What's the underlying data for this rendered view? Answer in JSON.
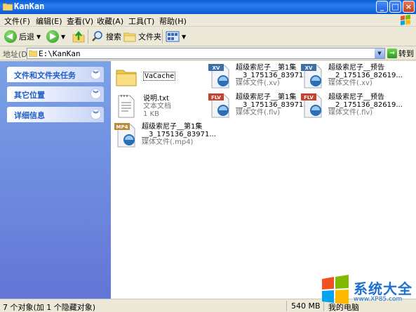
{
  "window": {
    "title": "KanKan",
    "minimize": "_",
    "maximize": "□",
    "close": "×"
  },
  "menu": [
    "文件(F)",
    "编辑(E)",
    "查看(V)",
    "收藏(A)",
    "工具(T)",
    "帮助(H)"
  ],
  "toolbar": {
    "back": "后退",
    "search": "搜索",
    "folders": "文件夹"
  },
  "address": {
    "label": "地址(D)",
    "path": "E:\\KanKan",
    "go": "转到"
  },
  "tasks": [
    {
      "title": "文件和文件夹任务"
    },
    {
      "title": "其它位置"
    },
    {
      "title": "详细信息"
    }
  ],
  "files": [
    {
      "name": "VaCache",
      "type": "folder",
      "l2": "",
      "l3": ""
    },
    {
      "name": "超级索尼子__第1集",
      "l2": "__3_175136_83971...",
      "l3": "媒体文件(.xv)",
      "badge": "XV",
      "badge_color": "#3d6fa6"
    },
    {
      "name": "超级索尼子__预告",
      "l2": "__2_175136_82619...",
      "l3": "媒体文件(.xv)",
      "badge": "XV",
      "badge_color": "#3d6fa6"
    },
    {
      "name": "说明.txt",
      "type": "txt",
      "l2": "文本文档",
      "l3": "1 KB"
    },
    {
      "name": "超级索尼子__第1集",
      "l2": "__3_175136_83971...",
      "l3": "媒体文件(.flv)",
      "badge": "FLV",
      "badge_color": "#c8412c"
    },
    {
      "name": "超级索尼子__预告",
      "l2": "__2_175136_82619...",
      "l3": "媒体文件(.flv)",
      "badge": "FLV",
      "badge_color": "#c8412c"
    },
    {
      "name": "超级索尼子__第1集",
      "l2": "__3_175136_83971...",
      "l3": "媒体文件(.mp4)",
      "badge": "MP4",
      "badge_color": "#b88a3a"
    }
  ],
  "status": {
    "left": "7 个对象(加 1 个隐藏对象)",
    "size": "540 MB",
    "computer": "我的电脑"
  },
  "watermark": {
    "title": "系统大全",
    "url": "www.XP85.com"
  }
}
